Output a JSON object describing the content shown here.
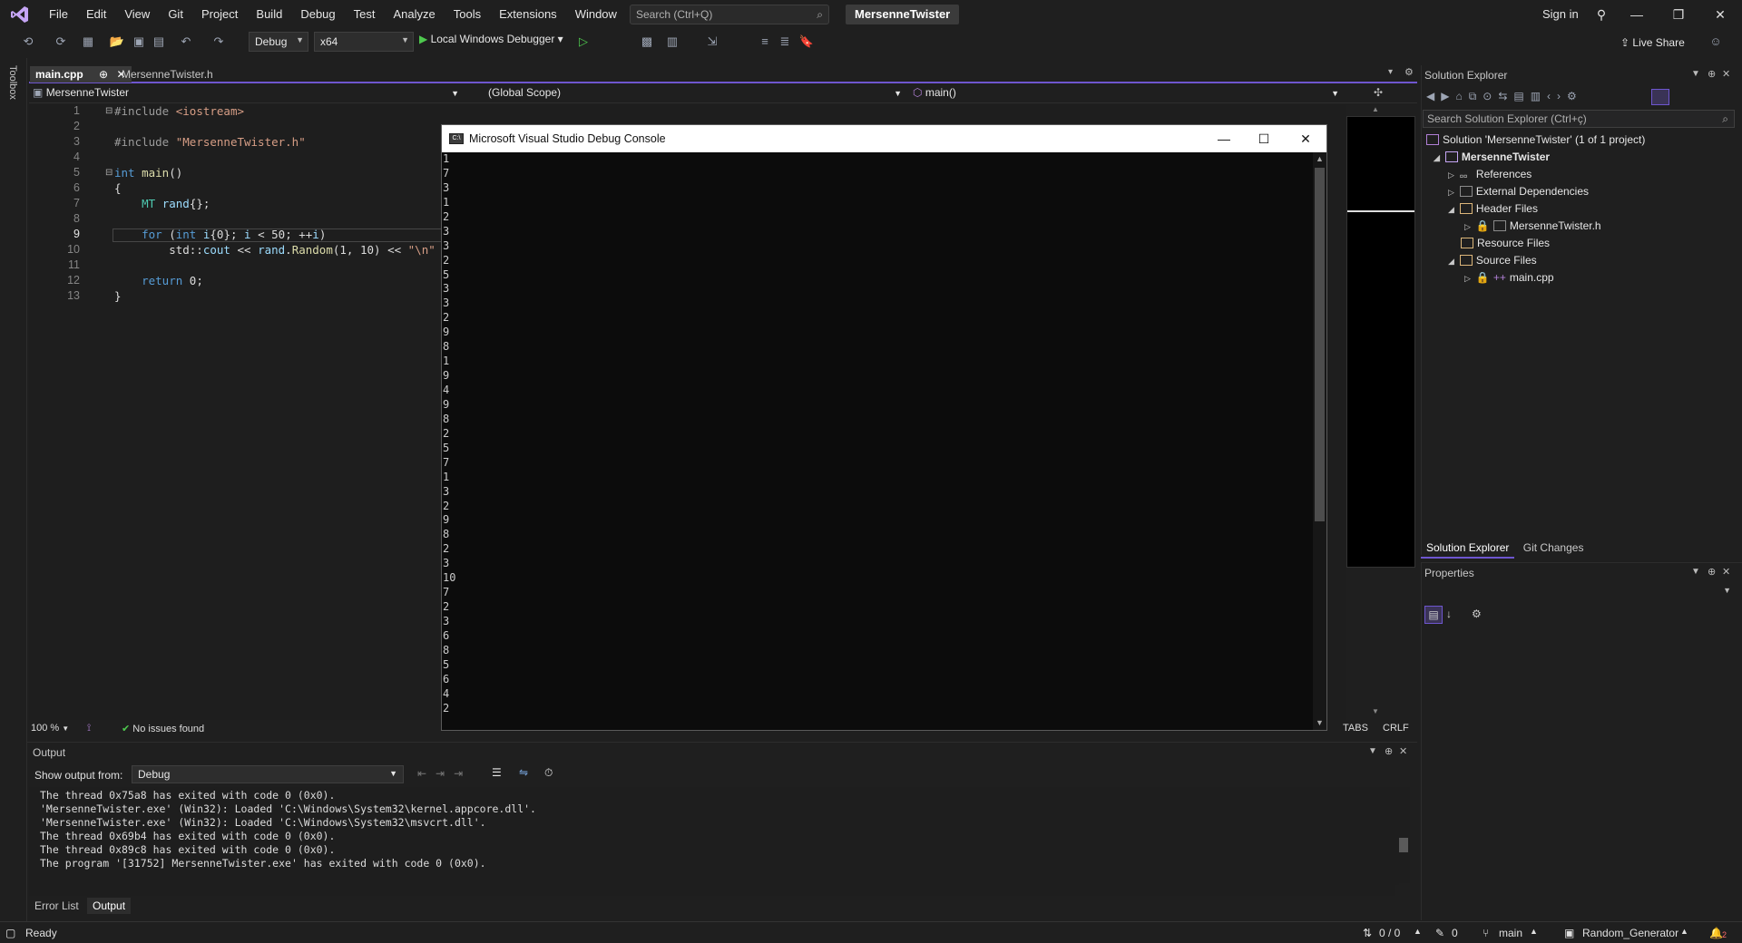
{
  "menu": {
    "items": [
      "File",
      "Edit",
      "View",
      "Git",
      "Project",
      "Build",
      "Debug",
      "Test",
      "Analyze",
      "Tools",
      "Extensions",
      "Window",
      "Help"
    ],
    "search_placeholder": "Search (Ctrl+Q)",
    "solution_name": "MersenneTwister",
    "sign_in": "Sign in"
  },
  "toolbar": {
    "config": "Debug",
    "platform": "x64",
    "debugger": "Local Windows Debugger",
    "live_share": "Live Share"
  },
  "toolbox_label": "Toolbox",
  "editor": {
    "tabs": [
      "main.cpp",
      "MersenneTwister.h"
    ],
    "nav_project": "MersenneTwister",
    "nav_scope": "(Global Scope)",
    "nav_function": "main()",
    "line_numbers": [
      "1",
      "2",
      "3",
      "4",
      "5",
      "6",
      "7",
      "8",
      "9",
      "10",
      "11",
      "12",
      "13"
    ],
    "zoom": "100 %",
    "issues": "No issues found",
    "tabs_mode": "TABS",
    "line_ending": "CRLF"
  },
  "console": {
    "title": "Microsoft Visual Studio Debug Console",
    "lines": [
      "1",
      "7",
      "3",
      "1",
      "2",
      "3",
      "3",
      "2",
      "5",
      "3",
      "3",
      "2",
      "9",
      "8",
      "1",
      "9",
      "4",
      "9",
      "8",
      "2",
      "5",
      "7",
      "1",
      "3",
      "2",
      "9",
      "8",
      "2",
      "3",
      "10",
      "7",
      "2",
      "3",
      "6",
      "8",
      "5",
      "6",
      "4",
      "2"
    ]
  },
  "solution_explorer": {
    "title": "Solution Explorer",
    "search_placeholder": "Search Solution Explorer (Ctrl+ç)",
    "solution": "Solution 'MersenneTwister' (1 of 1 project)",
    "project": "MersenneTwister",
    "nodes": {
      "references": "References",
      "external": "External Dependencies",
      "headers": "Header Files",
      "header_file": "MersenneTwister.h",
      "resources": "Resource Files",
      "sources": "Source Files",
      "source_file": "main.cpp"
    },
    "tabs": [
      "Solution Explorer",
      "Git Changes"
    ]
  },
  "properties": {
    "title": "Properties"
  },
  "output": {
    "title": "Output",
    "show_from_label": "Show output from:",
    "source": "Debug",
    "lines": [
      "The thread 0x75a8 has exited with code 0 (0x0).",
      "'MersenneTwister.exe' (Win32): Loaded 'C:\\Windows\\System32\\kernel.appcore.dll'.",
      "'MersenneTwister.exe' (Win32): Loaded 'C:\\Windows\\System32\\msvcrt.dll'.",
      "The thread 0x69b4 has exited with code 0 (0x0).",
      "The thread 0x89c8 has exited with code 0 (0x0).",
      "The program '[31752] MersenneTwister.exe' has exited with code 0 (0x0)."
    ],
    "tabs": [
      "Error List",
      "Output"
    ]
  },
  "statusbar": {
    "ready": "Ready",
    "sync": "0 / 0",
    "edits": "0",
    "branch": "main",
    "repo": "Random_Generator",
    "notifications": "2"
  },
  "colors": {
    "accent": "#6e56cf",
    "background": "#1f1f1f",
    "console_bg": "#0c0c0c"
  }
}
